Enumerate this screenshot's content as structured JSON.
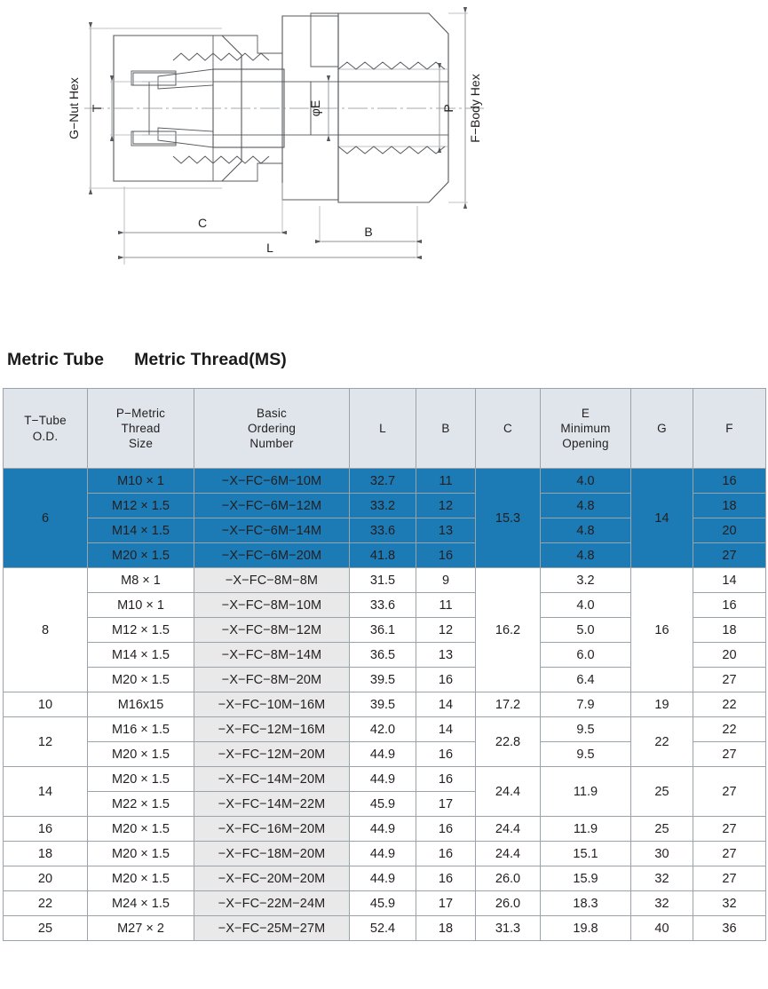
{
  "drawing": {
    "name": "tube-fitting-male-connector-cross-section",
    "labels": {
      "g_nut_hex": "G−Nut Hex",
      "t": "T",
      "phi_e": "φE",
      "p": "P",
      "f_body_hex": "F−Body Hex",
      "c": "C",
      "b": "B",
      "l": "L"
    },
    "colors": {
      "ferrule": "#1b7fa8",
      "nut_dark": "#7d8084",
      "body_light": "#d9d9d9",
      "thread": "#c6c6c6",
      "outline": "#55585c",
      "dimension_line": "#8b8f93"
    }
  },
  "titles": {
    "tube": "Metric Tube",
    "thread": "Metric Thread(MS)"
  },
  "table": {
    "headers": [
      "T−Tube\nO.D.",
      "P−Metric\nThread\nSize",
      "Basic\nOrdering\nNumber",
      "L",
      "B",
      "C",
      "E\nMinimum\nOpening",
      "G",
      "F"
    ],
    "header_lines": [
      [
        "T−Tube",
        "O.D."
      ],
      [
        "P−Metric",
        "Thread",
        "Size"
      ],
      [
        "Basic",
        "Ordering",
        "Number"
      ],
      [
        "L"
      ],
      [
        "B"
      ],
      [
        "C"
      ],
      [
        "E",
        "Minimum",
        "Opening"
      ],
      [
        "G"
      ],
      [
        "F"
      ]
    ],
    "highlight_color": "#1c7ab5",
    "header_color": "#dfe5ea",
    "order_col_color": "#e9e9e9",
    "groups": [
      {
        "tube_od": "6",
        "highlight": true,
        "c": "15.3",
        "g": "14",
        "rows": [
          {
            "thread": "M10 × 1",
            "order": "−X−FC−6M−10M",
            "l": "32.7",
            "b": "11",
            "e": "4.0",
            "f": "16"
          },
          {
            "thread": "M12 × 1.5",
            "order": "−X−FC−6M−12M",
            "l": "33.2",
            "b": "12",
            "e": "4.8",
            "f": "18"
          },
          {
            "thread": "M14 × 1.5",
            "order": "−X−FC−6M−14M",
            "l": "33.6",
            "b": "13",
            "e": "4.8",
            "f": "20"
          },
          {
            "thread": "M20 × 1.5",
            "order": "−X−FC−6M−20M",
            "l": "41.8",
            "b": "16",
            "e": "4.8",
            "f": "27"
          }
        ]
      },
      {
        "tube_od": "8",
        "highlight": false,
        "c": "16.2",
        "g": "16",
        "rows": [
          {
            "thread": "M8 × 1",
            "order": "−X−FC−8M−8M",
            "l": "31.5",
            "b": "9",
            "e": "3.2",
            "f": "14"
          },
          {
            "thread": "M10 × 1",
            "order": "−X−FC−8M−10M",
            "l": "33.6",
            "b": "11",
            "e": "4.0",
            "f": "16"
          },
          {
            "thread": "M12 × 1.5",
            "order": "−X−FC−8M−12M",
            "l": "36.1",
            "b": "12",
            "e": "5.0",
            "f": "18"
          },
          {
            "thread": "M14 × 1.5",
            "order": "−X−FC−8M−14M",
            "l": "36.5",
            "b": "13",
            "e": "6.0",
            "f": "20"
          },
          {
            "thread": "M20 × 1.5",
            "order": "−X−FC−8M−20M",
            "l": "39.5",
            "b": "16",
            "e": "6.4",
            "f": "27"
          }
        ]
      },
      {
        "tube_od": "10",
        "highlight": false,
        "c": "17.2",
        "g": "19",
        "rows": [
          {
            "thread": "M16x15",
            "order": "−X−FC−10M−16M",
            "l": "39.5",
            "b": "14",
            "e": "7.9",
            "f": "22"
          }
        ]
      },
      {
        "tube_od": "12",
        "highlight": false,
        "c": "22.8",
        "g": "22",
        "rows": [
          {
            "thread": "M16 × 1.5",
            "order": "−X−FC−12M−16M",
            "l": "42.0",
            "b": "14",
            "e": "9.5",
            "f": "22"
          },
          {
            "thread": "M20 × 1.5",
            "order": "−X−FC−12M−20M",
            "l": "44.9",
            "b": "16",
            "e": "9.5",
            "f": "27"
          }
        ]
      },
      {
        "tube_od": "14",
        "highlight": false,
        "c": "24.4",
        "g": "25",
        "e_merged": "11.9",
        "f_merged": "27",
        "rows": [
          {
            "thread": "M20 × 1.5",
            "order": "−X−FC−14M−20M",
            "l": "44.9",
            "b": "16"
          },
          {
            "thread": "M22 × 1.5",
            "order": "−X−FC−14M−22M",
            "l": "45.9",
            "b": "17"
          }
        ]
      },
      {
        "tube_od": "16",
        "highlight": false,
        "c": "24.4",
        "g": "25",
        "rows": [
          {
            "thread": "M20 × 1.5",
            "order": "−X−FC−16M−20M",
            "l": "44.9",
            "b": "16",
            "e": "11.9",
            "f": "27"
          }
        ]
      },
      {
        "tube_od": "18",
        "highlight": false,
        "c": "24.4",
        "g": "30",
        "rows": [
          {
            "thread": "M20 × 1.5",
            "order": "−X−FC−18M−20M",
            "l": "44.9",
            "b": "16",
            "e": "15.1",
            "f": "27"
          }
        ]
      },
      {
        "tube_od": "20",
        "highlight": false,
        "c": "26.0",
        "g": "32",
        "rows": [
          {
            "thread": "M20 × 1.5",
            "order": "−X−FC−20M−20M",
            "l": "44.9",
            "b": "16",
            "e": "15.9",
            "f": "27"
          }
        ]
      },
      {
        "tube_od": "22",
        "highlight": false,
        "c": "26.0",
        "g": "32",
        "rows": [
          {
            "thread": "M24 × 1.5",
            "order": "−X−FC−22M−24M",
            "l": "45.9",
            "b": "17",
            "e": "18.3",
            "f": "32"
          }
        ]
      },
      {
        "tube_od": "25",
        "highlight": false,
        "c": "31.3",
        "g": "40",
        "rows": [
          {
            "thread": "M27 × 2",
            "order": "−X−FC−25M−27M",
            "l": "52.4",
            "b": "18",
            "e": "19.8",
            "f": "36"
          }
        ]
      }
    ]
  }
}
